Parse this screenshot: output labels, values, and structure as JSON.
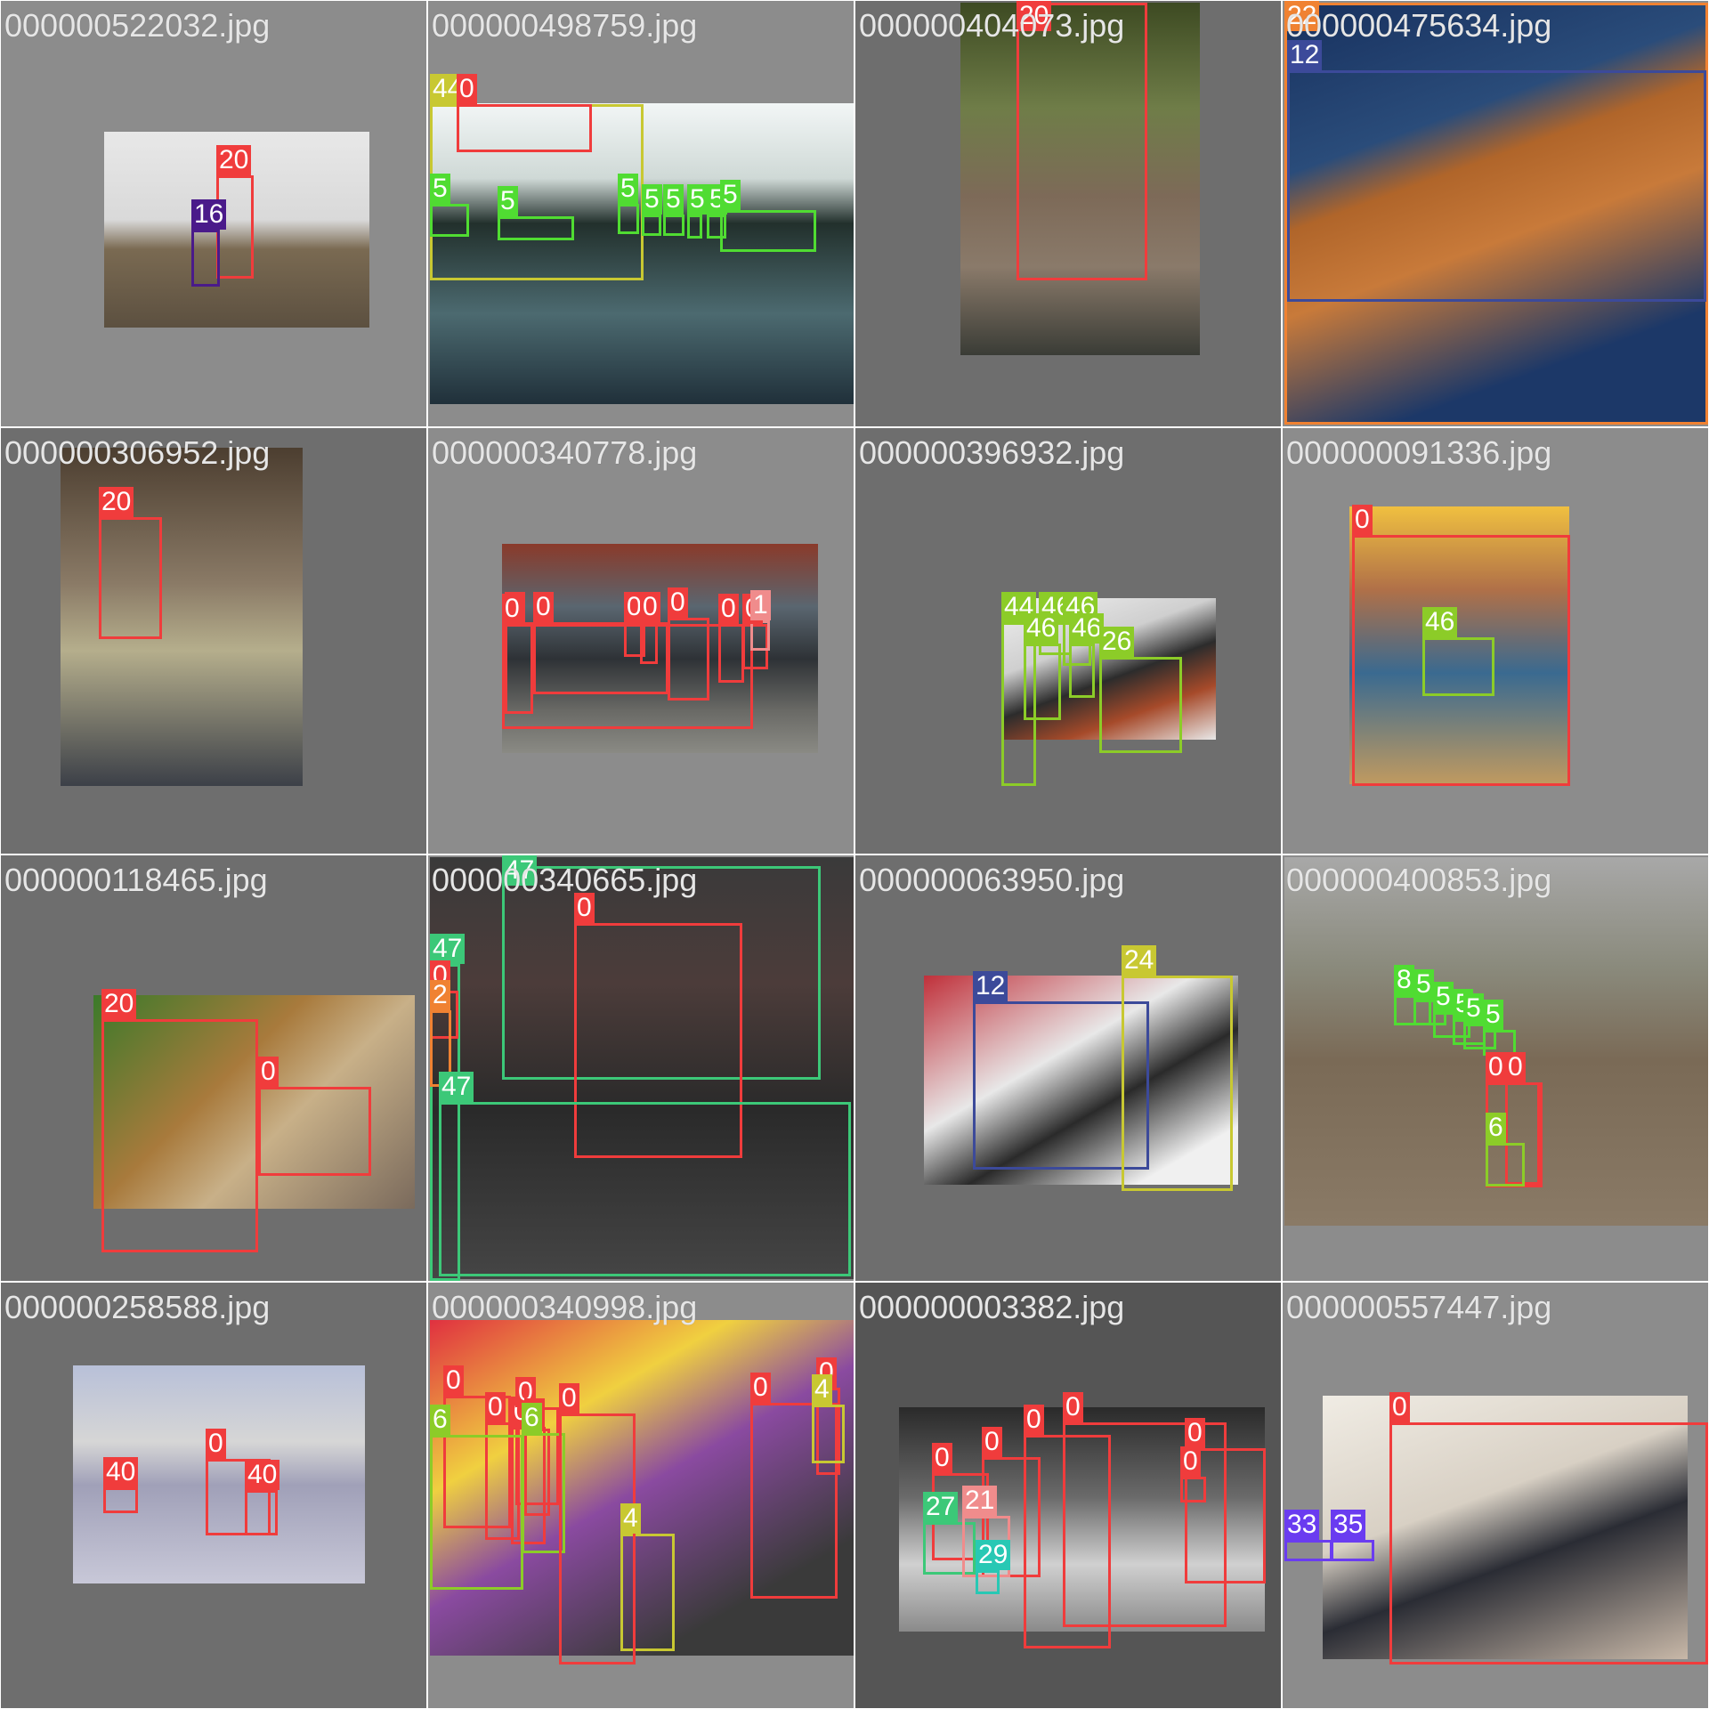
{
  "tiles": [
    {
      "file": "000000522032.jpg",
      "bg": "#8c8c8c",
      "boxes": [
        {
          "label": "20",
          "color": "#f03c3c"
        },
        {
          "label": "16",
          "color": "#4a1a8a"
        }
      ]
    },
    {
      "file": "000000498759.jpg",
      "bg": "#8c8c8c",
      "boxes": [
        {
          "label": "44",
          "color": "#c8c832"
        },
        {
          "label": "0",
          "color": "#f03c3c"
        },
        {
          "label": "5",
          "color": "#50dc32"
        },
        {
          "label": "5",
          "color": "#50dc32"
        },
        {
          "label": "5",
          "color": "#50dc32"
        },
        {
          "label": "5",
          "color": "#50dc32"
        },
        {
          "label": "5",
          "color": "#50dc32"
        },
        {
          "label": "5",
          "color": "#50dc32"
        },
        {
          "label": "5",
          "color": "#50dc32"
        },
        {
          "label": "5",
          "color": "#50dc32"
        }
      ]
    },
    {
      "file": "000000404073.jpg",
      "bg": "#6e6e6e",
      "boxes": [
        {
          "label": "20",
          "color": "#f03c3c"
        }
      ]
    },
    {
      "file": "000000475634.jpg",
      "bg": "#8c8c8c",
      "boxes": [
        {
          "label": "22",
          "color": "#f08232"
        },
        {
          "label": "12",
          "color": "#3c4a9a"
        }
      ]
    },
    {
      "file": "000000306952.jpg",
      "bg": "#6e6e6e",
      "boxes": [
        {
          "label": "20",
          "color": "#f03c3c"
        }
      ]
    },
    {
      "file": "000000340778.jpg",
      "bg": "#8c8c8c",
      "boxes": [
        {
          "label": "0",
          "color": "#f03c3c"
        },
        {
          "label": "0",
          "color": "#f03c3c"
        },
        {
          "label": "0",
          "color": "#f03c3c"
        },
        {
          "label": "0",
          "color": "#f03c3c"
        },
        {
          "label": "0",
          "color": "#f03c3c"
        },
        {
          "label": "0",
          "color": "#f03c3c"
        },
        {
          "label": "0",
          "color": "#f03c3c"
        },
        {
          "label": "0",
          "color": "#f03c3c"
        },
        {
          "label": "1",
          "color": "#f08c8c"
        }
      ]
    },
    {
      "file": "000000396932.jpg",
      "bg": "#6e6e6e",
      "boxes": [
        {
          "label": "44",
          "color": "#8ccc28"
        },
        {
          "label": "46",
          "color": "#8ccc28"
        },
        {
          "label": "46",
          "color": "#8ccc28"
        },
        {
          "label": "46",
          "color": "#8ccc28"
        },
        {
          "label": "46",
          "color": "#8ccc28"
        },
        {
          "label": "26",
          "color": "#8ccc28"
        }
      ]
    },
    {
      "file": "000000091336.jpg",
      "bg": "#8c8c8c",
      "boxes": [
        {
          "label": "0",
          "color": "#f03c3c"
        },
        {
          "label": "46",
          "color": "#8ccc28"
        }
      ]
    },
    {
      "file": "000000118465.jpg",
      "bg": "#6e6e6e",
      "boxes": [
        {
          "label": "20",
          "color": "#f03c3c"
        },
        {
          "label": "0",
          "color": "#f03c3c"
        }
      ]
    },
    {
      "file": "000000340665.jpg",
      "bg": "#8c8c8c",
      "boxes": [
        {
          "label": "47",
          "color": "#3cc878"
        },
        {
          "label": "0",
          "color": "#f03c3c"
        },
        {
          "label": "47",
          "color": "#3cc878"
        },
        {
          "label": "0",
          "color": "#f03c3c"
        },
        {
          "label": "2",
          "color": "#f08232"
        },
        {
          "label": "47",
          "color": "#3cc878"
        }
      ]
    },
    {
      "file": "000000063950.jpg",
      "bg": "#6e6e6e",
      "boxes": [
        {
          "label": "12",
          "color": "#3c4a9a"
        },
        {
          "label": "24",
          "color": "#c8c832"
        }
      ]
    },
    {
      "file": "000000400853.jpg",
      "bg": "#8c8c8c",
      "boxes": [
        {
          "label": "8",
          "color": "#50dc32"
        },
        {
          "label": "5",
          "color": "#50dc32"
        },
        {
          "label": "5",
          "color": "#50dc32"
        },
        {
          "label": "5",
          "color": "#50dc32"
        },
        {
          "label": "5",
          "color": "#50dc32"
        },
        {
          "label": "5",
          "color": "#50dc32"
        },
        {
          "label": "0",
          "color": "#f03c3c"
        },
        {
          "label": "0",
          "color": "#f03c3c"
        },
        {
          "label": "6",
          "color": "#8ccc28"
        }
      ]
    },
    {
      "file": "000000258588.jpg",
      "bg": "#6e6e6e",
      "boxes": [
        {
          "label": "0",
          "color": "#f03c3c"
        },
        {
          "label": "40",
          "color": "#f03c3c"
        },
        {
          "label": "40",
          "color": "#f03c3c"
        }
      ]
    },
    {
      "file": "000000340998.jpg",
      "bg": "#8c8c8c",
      "boxes": [
        {
          "label": "0",
          "color": "#f03c3c"
        },
        {
          "label": "0",
          "color": "#f03c3c"
        },
        {
          "label": "0",
          "color": "#f03c3c"
        },
        {
          "label": "0",
          "color": "#f03c3c"
        },
        {
          "label": "0",
          "color": "#f03c3c"
        },
        {
          "label": "0",
          "color": "#f03c3c"
        },
        {
          "label": "0",
          "color": "#f03c3c"
        },
        {
          "label": "6",
          "color": "#8ccc28"
        },
        {
          "label": "6",
          "color": "#8ccc28"
        },
        {
          "label": "4",
          "color": "#c8c832"
        },
        {
          "label": "4",
          "color": "#c8c832"
        },
        {
          "label": "0",
          "color": "#f03c3c"
        }
      ]
    },
    {
      "file": "000000003382.jpg",
      "bg": "#555555",
      "boxes": [
        {
          "label": "0",
          "color": "#f03c3c"
        },
        {
          "label": "0",
          "color": "#f03c3c"
        },
        {
          "label": "0",
          "color": "#f03c3c"
        },
        {
          "label": "0",
          "color": "#f03c3c"
        },
        {
          "label": "0",
          "color": "#f03c3c"
        },
        {
          "label": "0",
          "color": "#f03c3c"
        },
        {
          "label": "27",
          "color": "#3cc878"
        },
        {
          "label": "21",
          "color": "#f08c8c"
        },
        {
          "label": "29",
          "color": "#28c8b4"
        }
      ]
    },
    {
      "file": "000000557447.jpg",
      "bg": "#8c8c8c",
      "boxes": [
        {
          "label": "0",
          "color": "#f03c3c"
        },
        {
          "label": "33",
          "color": "#6a3cf0"
        },
        {
          "label": "35",
          "color": "#6a3cf0"
        }
      ]
    }
  ]
}
